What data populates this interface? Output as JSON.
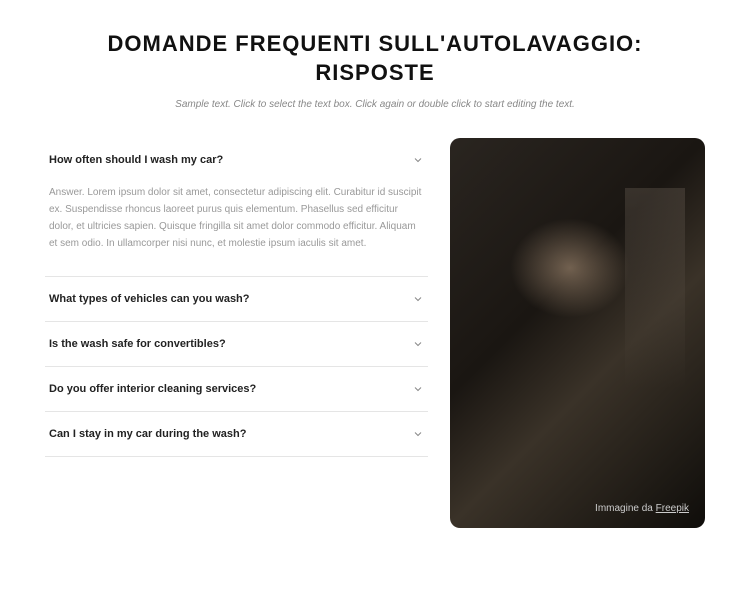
{
  "header": {
    "title": "DOMANDE FREQUENTI SULL'AUTOLAVAGGIO: RISPOSTE",
    "subtitle": "Sample text. Click to select the text box. Click again or double click to start editing the text."
  },
  "accordion": {
    "items": [
      {
        "question": "How often should I wash my car?",
        "answer": "Answer. Lorem ipsum dolor sit amet, consectetur adipiscing elit. Curabitur id suscipit ex. Suspendisse rhoncus laoreet purus quis elementum. Phasellus sed efficitur dolor, et ultricies sapien. Quisque fringilla sit amet dolor commodo efficitur. Aliquam et sem odio. In ullamcorper nisi nunc, et molestie ipsum iaculis sit amet.",
        "expanded": true
      },
      {
        "question": "What types of vehicles can you wash?",
        "expanded": false
      },
      {
        "question": "Is the wash safe for convertibles?",
        "expanded": false
      },
      {
        "question": "Do you offer interior cleaning services?",
        "expanded": false
      },
      {
        "question": "Can I stay in my car during the wash?",
        "expanded": false
      }
    ]
  },
  "image": {
    "caption_prefix": "Immagine da ",
    "caption_link": "Freepik"
  }
}
